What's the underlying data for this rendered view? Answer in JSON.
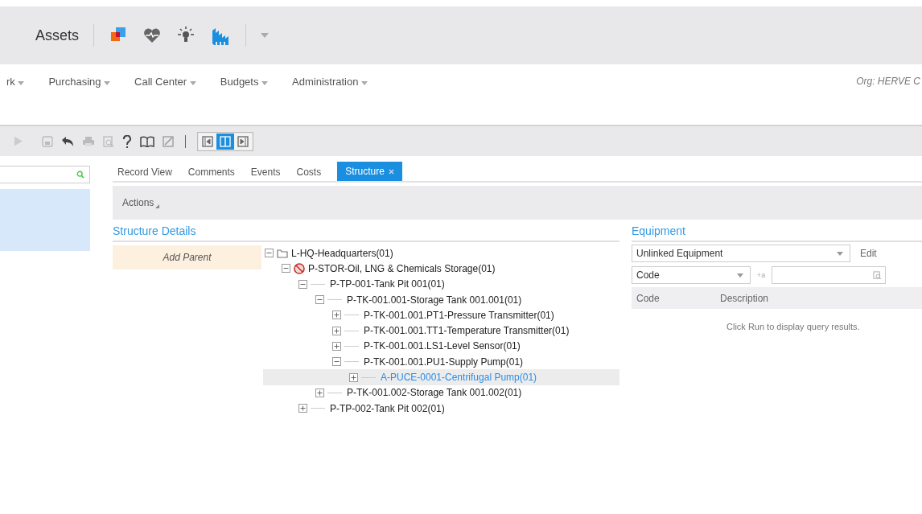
{
  "header": {
    "title": "Assets"
  },
  "nav": [
    {
      "label": "rk"
    },
    {
      "label": "Purchasing"
    },
    {
      "label": "Call Center"
    },
    {
      "label": "Budgets"
    },
    {
      "label": "Administration"
    }
  ],
  "org": "Org: HERVE C",
  "layout_buttons": [
    {
      "selected": false
    },
    {
      "selected": true
    },
    {
      "selected": false
    }
  ],
  "tabs": [
    {
      "label": "Record View",
      "selected": false
    },
    {
      "label": "Comments",
      "selected": false
    },
    {
      "label": "Events",
      "selected": false
    },
    {
      "label": "Costs",
      "selected": false
    },
    {
      "label": "Structure",
      "selected": true,
      "closable": true
    }
  ],
  "actions": "Actions",
  "structure": {
    "title": "Structure Details",
    "add_parent": "Add Parent",
    "tree": [
      {
        "label": "L-HQ-Headquarters(01)",
        "kind": "folder",
        "expanded": true,
        "selected": false,
        "children": [
          {
            "label": "P-STOR-Oil, LNG & Chemicals Storage(01)",
            "kind": "restricted",
            "expanded": true,
            "selected": false,
            "children": [
              {
                "label": "P-TP-001-Tank Pit 001(01)",
                "kind": "plain",
                "expanded": true,
                "selected": false,
                "children": [
                  {
                    "label": "P-TK-001.001-Storage Tank 001.001(01)",
                    "kind": "plain",
                    "expanded": true,
                    "selected": false,
                    "children": [
                      {
                        "label": "P-TK-001.001.PT1-Pressure Transmitter(01)",
                        "kind": "plain",
                        "expanded": false,
                        "selected": false
                      },
                      {
                        "label": "P-TK-001.001.TT1-Temperature Transmitter(01)",
                        "kind": "plain",
                        "expanded": false,
                        "selected": false
                      },
                      {
                        "label": "P-TK-001.001.LS1-Level Sensor(01)",
                        "kind": "plain",
                        "expanded": false,
                        "selected": false
                      },
                      {
                        "label": "P-TK-001.001.PU1-Supply Pump(01)",
                        "kind": "plain",
                        "expanded": true,
                        "selected": false,
                        "children": [
                          {
                            "label": "A-PUCE-0001-Centrifugal Pump(01)",
                            "kind": "plain",
                            "expanded": false,
                            "selected": true
                          }
                        ]
                      }
                    ]
                  },
                  {
                    "label": "P-TK-001.002-Storage Tank 001.002(01)",
                    "kind": "plain",
                    "expanded": false,
                    "selected": false
                  }
                ]
              },
              {
                "label": "P-TP-002-Tank Pit 002(01)",
                "kind": "plain",
                "expanded": false,
                "selected": false
              }
            ]
          }
        ]
      }
    ]
  },
  "equipment": {
    "title": "Equipment",
    "dataspy": "Unlinked Equipment",
    "edit": "Edit",
    "filter_field": "Code",
    "operator": "+a",
    "columns": [
      "Code",
      "Description"
    ],
    "empty_message": "Click Run to display query results."
  }
}
